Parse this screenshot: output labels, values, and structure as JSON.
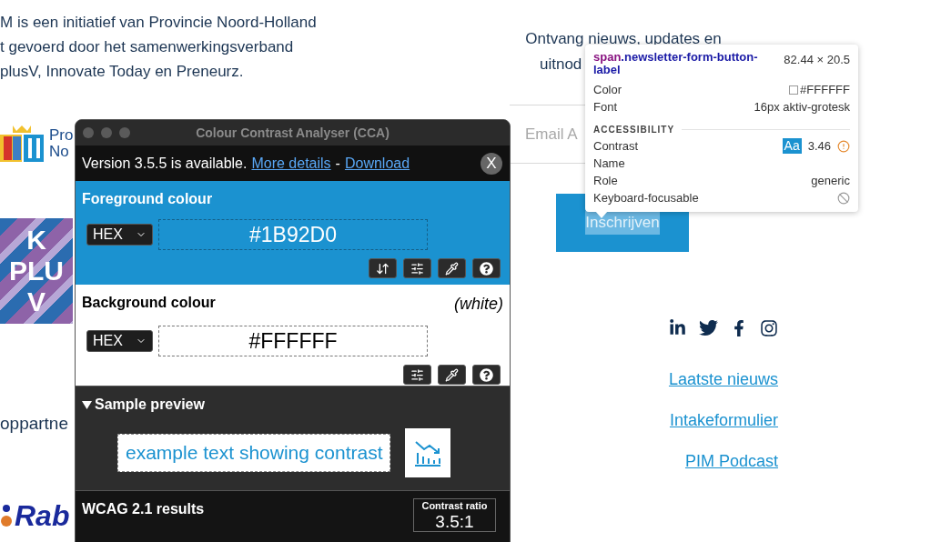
{
  "page": {
    "intro_lines": [
      "M is een initiatief van Provincie Noord-Holland",
      "t gevoerd door het samenwerkingsverband",
      "plusV, Innovate Today en Preneurz."
    ],
    "province_logo": {
      "lines": [
        "Pro",
        "No"
      ]
    },
    "kplusv_logo": {
      "lines": [
        "K",
        "PLU",
        "V"
      ]
    },
    "partners_heading": "oppartne",
    "bank_logo": {
      "text": "Rab"
    },
    "newsletter": {
      "heading_lines": [
        "Ontvang nieuws, updates en",
        "uitnod"
      ],
      "email_placeholder": "Email A",
      "button": "Inschrijven",
      "button_text_selected": true
    },
    "footer_links": [
      "Laatste nieuws",
      "Intakeformulier",
      "PIM Podcast"
    ]
  },
  "cca_window": {
    "title": "Colour Contrast Analyser (CCA)",
    "notice": {
      "text": "Version 3.5.5 is available.",
      "links": [
        "More details",
        "Download"
      ],
      "separator": "-",
      "close": "X"
    },
    "foreground": {
      "heading": "Foreground colour",
      "format": "HEX",
      "value": "#1B92D0"
    },
    "background": {
      "heading": "Background colour",
      "note": "(white)",
      "format": "HEX",
      "value": "#FFFFFF"
    },
    "sample": {
      "heading": "Sample preview",
      "expanded": true,
      "text": "example text showing contrast"
    },
    "results": {
      "heading": "WCAG 2.1 results",
      "ratio_label": "Contrast ratio",
      "ratio": "3.5:1"
    }
  },
  "inspector_tooltip": {
    "tag": "span",
    "class_name": ".newsletter-form-button-label",
    "size": "82.44 × 20.5",
    "rows": [
      {
        "kind": "swatch",
        "label": "Color",
        "value": "#FFFFFF"
      },
      {
        "kind": "text",
        "label": "Font",
        "value": "16px aktiv-grotesk"
      }
    ],
    "section": "ACCESSIBILITY",
    "accessibility_rows": [
      {
        "kind": "contrast",
        "label": "Contrast",
        "badge": "Aa",
        "value": "3.46"
      },
      {
        "kind": "empty",
        "label": "Name"
      },
      {
        "kind": "text",
        "label": "Role",
        "value": "generic"
      },
      {
        "kind": "blocked",
        "label": "Keyboard-focusable"
      }
    ]
  }
}
